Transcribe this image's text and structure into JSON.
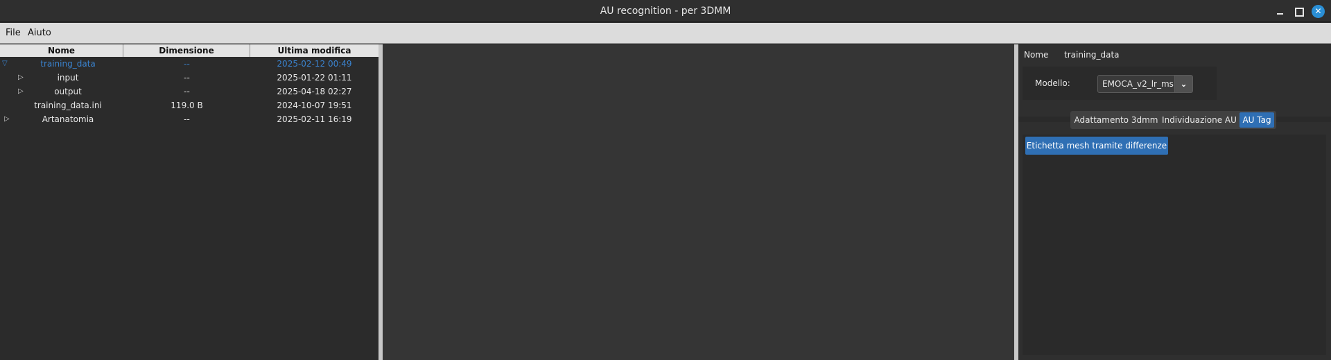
{
  "window": {
    "title": "AU recognition - per 3DMM",
    "close_glyph": "✕"
  },
  "menu": {
    "file": "File",
    "aiuto": "Aiuto"
  },
  "tree": {
    "columns": [
      "Nome",
      "Dimensione",
      "Ultima modifica"
    ],
    "rows": [
      {
        "name": "training_data",
        "size": "--",
        "modified": "2025-02-12 00:49",
        "expander": "▽"
      },
      {
        "name": "input",
        "size": "--",
        "modified": "2025-01-22 01:11",
        "expander": "▷"
      },
      {
        "name": "output",
        "size": "--",
        "modified": "2025-04-18 02:27",
        "expander": "▷"
      },
      {
        "name": "training_data.ini",
        "size": "119.0 B",
        "modified": "2024-10-07 19:51",
        "expander": ""
      },
      {
        "name": "Artanatomia",
        "size": "--",
        "modified": "2025-02-11 16:19",
        "expander": "▷"
      }
    ]
  },
  "details": {
    "name_label": "Nome",
    "name_value": "training_data",
    "model_label": "Modello:",
    "model_value": "EMOCA_v2_lr_ms",
    "model_dropdown_glyph": "⌄",
    "tabs": [
      "Adattamento 3dmm",
      "Individuazione AU",
      "AU Tag"
    ],
    "active_tab": "AU Tag",
    "action_button": "Etichetta mesh tramite differenze"
  },
  "colors": {
    "accent": "#2f6fb4",
    "selected_text": "#3a83cf",
    "close_button": "#2a8fd6"
  }
}
